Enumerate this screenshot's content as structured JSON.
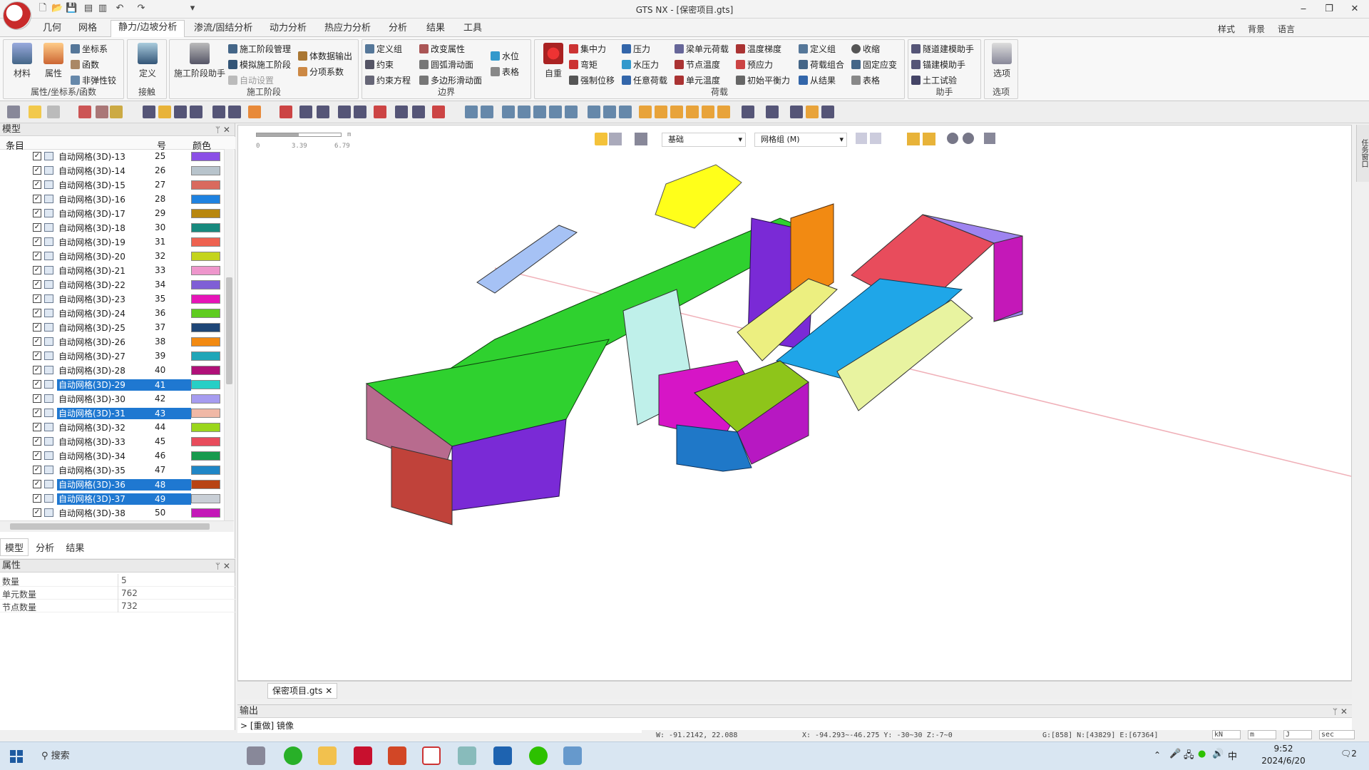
{
  "window": {
    "title": "GTS NX - [保密项目.gts]",
    "min": "‒",
    "restore": "❐",
    "close": "✕"
  },
  "menu": {
    "items": [
      "几何",
      "网格",
      "静力/边坡分析",
      "渗流/固结分析",
      "动力分析",
      "热应力分析",
      "分析",
      "结果",
      "工具"
    ],
    "active": "静力/边坡分析",
    "right": [
      "样式",
      "背景",
      "语言"
    ]
  },
  "ribbon": {
    "group1": {
      "label": "属性/坐标系/函数",
      "big": [
        "材料",
        "属性"
      ],
      "small": [
        "坐标系",
        "函数",
        "非弹性铰"
      ]
    },
    "group2": {
      "label": "接触",
      "big": [
        "定义"
      ]
    },
    "group3": {
      "label": "施工阶段",
      "big": [
        "施工阶段助手"
      ],
      "small": [
        "施工阶段管理",
        "模拟施工阶段",
        "自动设置",
        "体数据输出",
        "分项系数"
      ]
    },
    "group4": {
      "label": "边界",
      "small": [
        "定义组",
        "约束",
        "约束方程",
        "改变属性",
        "圆弧滑动面",
        "多边形滑动面",
        "水位",
        "表格"
      ]
    },
    "group5": {
      "label": "荷载",
      "big": [
        "自重"
      ],
      "small": [
        "集中力",
        "弯矩",
        "强制位移",
        "压力",
        "水压力",
        "任意荷载",
        "梁单元荷载",
        "节点温度",
        "单元温度",
        "温度梯度",
        "预应力",
        "初始平衡力",
        "定义组",
        "荷载组合",
        "从结果",
        "收缩",
        "固定应变",
        "表格"
      ]
    },
    "group6": {
      "label": "助手",
      "small": [
        "隧道建模助手",
        "锚建模助手",
        "土工试验"
      ]
    },
    "group7": {
      "label": "选项",
      "big": [
        "选项"
      ]
    }
  },
  "model_panel": {
    "title": "模型",
    "columns": [
      "条目",
      "号",
      "颜色"
    ],
    "rows": [
      {
        "name": "自动网格(3D)-13",
        "id": "25",
        "color": "#8b4fe6",
        "sel": false
      },
      {
        "name": "自动网格(3D)-14",
        "id": "26",
        "color": "#b8c4cc",
        "sel": false
      },
      {
        "name": "自动网格(3D)-15",
        "id": "27",
        "color": "#d96a5e",
        "sel": false
      },
      {
        "name": "自动网格(3D)-16",
        "id": "28",
        "color": "#1f82e0",
        "sel": false
      },
      {
        "name": "自动网格(3D)-17",
        "id": "29",
        "color": "#b8870e",
        "sel": false
      },
      {
        "name": "自动网格(3D)-18",
        "id": "30",
        "color": "#178a7e",
        "sel": false
      },
      {
        "name": "自动网格(3D)-19",
        "id": "31",
        "color": "#ee6250",
        "sel": false
      },
      {
        "name": "自动网格(3D)-20",
        "id": "32",
        "color": "#c4d41c",
        "sel": false
      },
      {
        "name": "自动网格(3D)-21",
        "id": "33",
        "color": "#ee96cc",
        "sel": false
      },
      {
        "name": "自动网格(3D)-22",
        "id": "34",
        "color": "#7f5fd6",
        "sel": false
      },
      {
        "name": "自动网格(3D)-23",
        "id": "35",
        "color": "#e614b8",
        "sel": false
      },
      {
        "name": "自动网格(3D)-24",
        "id": "36",
        "color": "#5fcc20",
        "sel": false
      },
      {
        "name": "自动网格(3D)-25",
        "id": "37",
        "color": "#1e4677",
        "sel": false
      },
      {
        "name": "自动网格(3D)-26",
        "id": "38",
        "color": "#f28a12",
        "sel": false
      },
      {
        "name": "自动网格(3D)-27",
        "id": "39",
        "color": "#1fa6b8",
        "sel": false
      },
      {
        "name": "自动网格(3D)-28",
        "id": "40",
        "color": "#b01078",
        "sel": false
      },
      {
        "name": "自动网格(3D)-29",
        "id": "41",
        "color": "#26cfc6",
        "sel": true
      },
      {
        "name": "自动网格(3D)-30",
        "id": "42",
        "color": "#a69cf0",
        "sel": false
      },
      {
        "name": "自动网格(3D)-31",
        "id": "43",
        "color": "#f0b8a6",
        "sel": true
      },
      {
        "name": "自动网格(3D)-32",
        "id": "44",
        "color": "#9ad61c",
        "sel": false
      },
      {
        "name": "自动网格(3D)-33",
        "id": "45",
        "color": "#e84c5c",
        "sel": false
      },
      {
        "name": "自动网格(3D)-34",
        "id": "46",
        "color": "#179a4e",
        "sel": false
      },
      {
        "name": "自动网格(3D)-35",
        "id": "47",
        "color": "#1f86c6",
        "sel": false
      },
      {
        "name": "自动网格(3D)-36",
        "id": "48",
        "color": "#b84414",
        "sel": true
      },
      {
        "name": "自动网格(3D)-37",
        "id": "49",
        "color": "#c9cfd6",
        "sel": true
      },
      {
        "name": "自动网格(3D)-38",
        "id": "50",
        "color": "#c418b8",
        "sel": false
      }
    ],
    "tabs": [
      "模型",
      "分析",
      "结果"
    ]
  },
  "props_panel": {
    "title": "属性",
    "rows": [
      {
        "k": "数量",
        "v": "5"
      },
      {
        "k": "单元数量",
        "v": "762"
      },
      {
        "k": "节点数量",
        "v": "732"
      }
    ]
  },
  "viewport": {
    "scale": {
      "a": "0",
      "b": "3.39",
      "c": "6.79",
      "unit": "m"
    },
    "drop1": "基础",
    "drop2": "网格组 (M)",
    "side_tab": "任务窗口"
  },
  "doc_tab": "保密项目.gts",
  "output": {
    "title": "输出",
    "line": "> [重做] 镜像"
  },
  "status": {
    "w": "W: -91.2142, 22.088",
    "xyz": "X: -94.293~-46.275 Y: -30~30 Z:-7~0",
    "g": "G:[858] N:[43829] E:[67364]",
    "u1": "kN",
    "u2": "m",
    "u3": "J",
    "u4": "sec"
  },
  "taskbar": {
    "search": "搜索",
    "time": "9:52",
    "date": "2024/6/20",
    "ime": "中",
    "notif": "2"
  }
}
